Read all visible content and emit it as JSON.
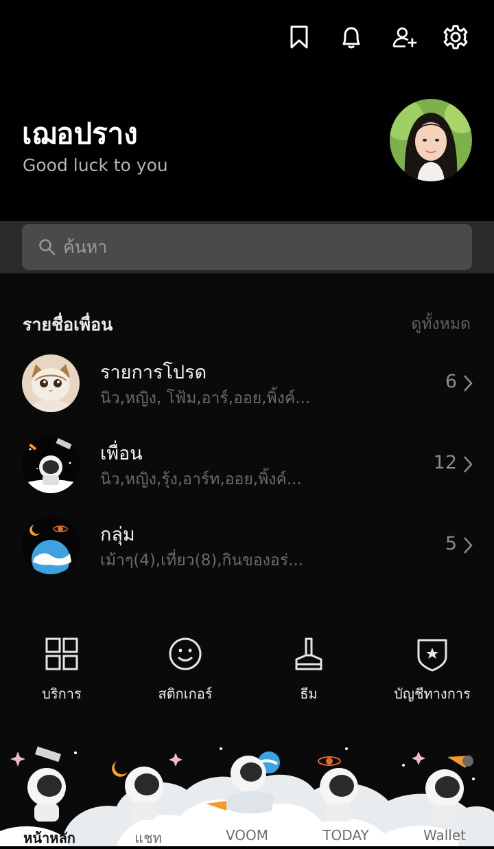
{
  "header": {
    "icons": [
      "bookmark-icon",
      "bell-icon",
      "add-friend-icon",
      "settings-icon"
    ]
  },
  "profile": {
    "name": "เฌอปราง",
    "status": "Good luck to you"
  },
  "search": {
    "placeholder": "ค้นหา"
  },
  "friends_section": {
    "title": "รายชื่อเพื่อน",
    "see_all": "ดูทั้งหมด",
    "rows": [
      {
        "title": "รายการโปรด",
        "subtitle": "นิว,หญิง, โฟ้ม,อาร์,ออย,พิ้งค์...",
        "count": "6"
      },
      {
        "title": "เพื่อน",
        "subtitle": "นิว,หญิง,รุ้ง,อาร์ท,ออย,พิ้งค์...",
        "count": "12"
      },
      {
        "title": "กลุ่ม",
        "subtitle": "เม้าๆ(4),เที่ยว(8),กินของอร่...",
        "count": "5"
      }
    ]
  },
  "services": [
    {
      "label": "บริการ",
      "icon": "grid-icon"
    },
    {
      "label": "สติกเกอร์",
      "icon": "smiley-icon"
    },
    {
      "label": "ธีม",
      "icon": "brush-icon"
    },
    {
      "label": "บัญชีทางการ",
      "icon": "shield-star-icon"
    }
  ],
  "tabs": [
    {
      "label": "หน้าหลัก",
      "active": true
    },
    {
      "label": "แชท",
      "active": false
    },
    {
      "label": "VOOM",
      "active": false
    },
    {
      "label": "TODAY",
      "active": false
    },
    {
      "label": "Wallet",
      "active": false
    }
  ]
}
